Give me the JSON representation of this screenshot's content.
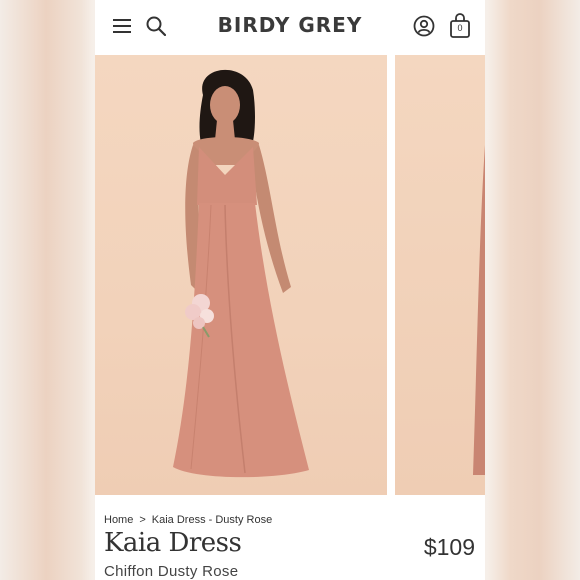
{
  "header": {
    "logo": "BIRDY GREY",
    "bag_count": "0",
    "icons": [
      "menu-icon",
      "search-icon",
      "account-icon",
      "bag-icon"
    ]
  },
  "colors": {
    "backdrop": "#f2d2ba",
    "dress": "#d6907d",
    "text": "#333333"
  },
  "breadcrumb": {
    "home": "Home",
    "separator": ">",
    "current": "Kaia Dress - Dusty Rose"
  },
  "product": {
    "name": "Kaia Dress",
    "price": "$109",
    "variant": "Chiffon Dusty Rose"
  }
}
